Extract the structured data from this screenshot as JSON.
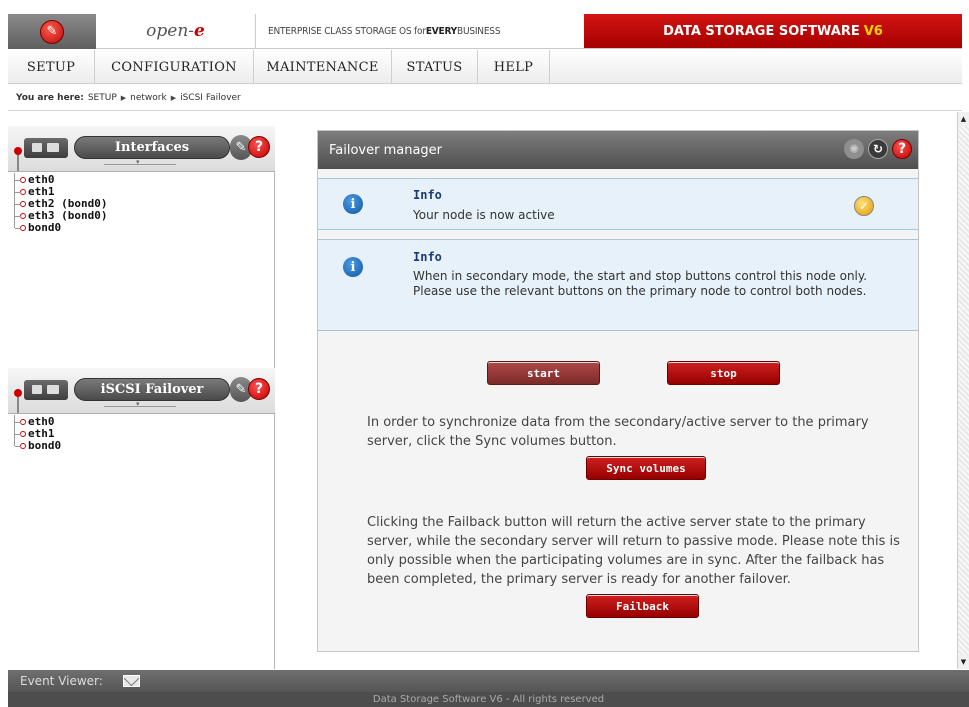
{
  "header": {
    "brand_prefix": "open-",
    "brand_suffix": "e",
    "tagline_plain": "ENTERPRISE CLASS STORAGE OS for ",
    "tagline_bold": "EVERY",
    "tagline_end": " BUSINESS",
    "product": "DATA STORAGE SOFTWARE",
    "product_version": "V6"
  },
  "menu": {
    "items": [
      {
        "label": "SETUP"
      },
      {
        "label": "CONFIGURATION"
      },
      {
        "label": "MAINTENANCE"
      },
      {
        "label": "STATUS"
      },
      {
        "label": "HELP"
      }
    ]
  },
  "breadcrumb": {
    "prefix": "You are here:",
    "items": [
      "SETUP",
      "network",
      "iSCSI Failover"
    ]
  },
  "sidebar": {
    "interfaces": {
      "title": "Interfaces",
      "items": [
        "eth0",
        "eth1",
        "eth2 (bond0)",
        "eth3 (bond0)",
        "bond0"
      ]
    },
    "iscsi_failover": {
      "title": "iSCSI Failover",
      "items": [
        "eth0",
        "eth1",
        "bond0"
      ]
    }
  },
  "failover": {
    "title": "Failover manager",
    "info1": {
      "title": "Info",
      "text": "Your node is now active"
    },
    "info2": {
      "title": "Info",
      "text": "When in secondary mode, the start and stop buttons control this node only. Please use the relevant buttons on the primary node to control both nodes."
    },
    "start_label": "start",
    "stop_label": "stop",
    "sync_text": "In order to synchronize data from the secondary/active server to the primary server, click the Sync volumes button.",
    "sync_label": "Sync volumes",
    "failback_text": "Clicking the Failback button will return the active server state to the primary server, while the secondary server will return to passive mode. Please note this is only possible when the participating volumes are in sync. After the failback has been completed, the primary server is ready for another failover.",
    "failback_label": "Failback"
  },
  "footer": {
    "event_viewer": "Event Viewer:",
    "copyright": "Data Storage Software V6 - All rights reserved"
  },
  "icons": {
    "logo": "wrench-logo-icon",
    "interfaces": "network-card-icon",
    "iscsi": "failover-hand-icon",
    "tools": "wrench-icon",
    "help": "help-icon",
    "info": "info-icon",
    "status_ok": "checkmark-icon",
    "settings": "gear-icon",
    "refresh": "refresh-icon",
    "mail": "mail-icon"
  },
  "colors": {
    "brand_red": "#c00000",
    "version_yellow": "#ffd200",
    "info_blue": "#1a3c6e",
    "info_bg": "#e7f1f9"
  }
}
